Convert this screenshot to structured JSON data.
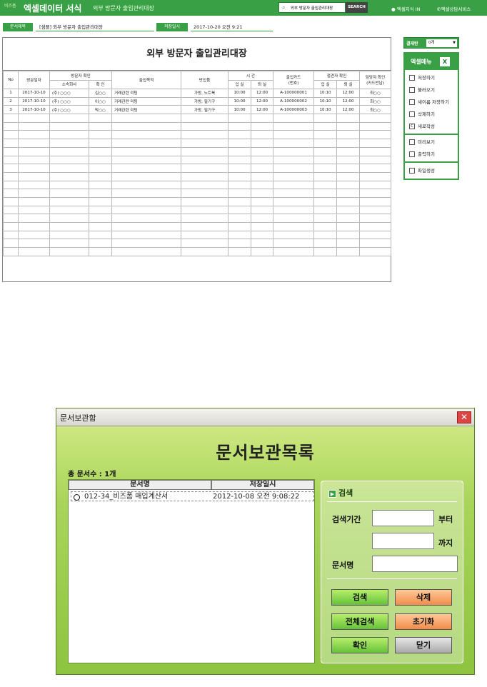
{
  "topbar": {
    "brand_small": "비즈폼",
    "brand": "엑셀데이터 서식",
    "subtitle": "외부 방문자 출입관리대장",
    "search_value": "외부 방문자 출입관리대장",
    "search_button": "SEARCH",
    "link1": "엑셀지식 IN",
    "link2": "엑셀상담서비스",
    "bg_color": "#3aa046"
  },
  "docinfo": {
    "name_label": "문서제목",
    "name_value": "[샘플] 외부 방문자 출입관리대장",
    "date_label": "저장일시",
    "date_value": "2017-10-20  오전 9:21"
  },
  "sheet": {
    "title": "외부 방문자 출입관리대장",
    "headers": {
      "no": "No",
      "date": "방문일자",
      "visitor": "방문자 확인",
      "company": "소속회사",
      "check": "확 인",
      "purpose": "출입목적",
      "items": "반입품",
      "time": "시 간",
      "time_in": "입 실",
      "time_out": "퇴 실",
      "card": "출입카드",
      "card_sub": "(번호)",
      "contact": "접견자 확인",
      "contact_in": "입 실",
      "contact_out": "퇴 실",
      "manager": "담당자 확인",
      "manager_sub": "(카드반납)"
    },
    "rows": [
      [
        "1",
        "2017-10-10",
        "(주) ○○○",
        "김○○",
        "거래관련 미팅",
        "가방, 노트북",
        "10:00",
        "12:00",
        "A-100000001",
        "10:10",
        "12:00",
        "최○○"
      ],
      [
        "2",
        "2017-10-10",
        "(주) ○○○",
        "이○○",
        "거래관련 미팅",
        "가방, 필기구",
        "10:00",
        "12:00",
        "A-100000002",
        "10:10",
        "12:00",
        "최○○"
      ],
      [
        "3",
        "2017-10-10",
        "(주) ○○○",
        "박○○",
        "거래관련 미팅",
        "가방, 필기구",
        "10:00",
        "12:00",
        "A-100000003",
        "10:10",
        "12:00",
        "최○○"
      ]
    ]
  },
  "side": {
    "approval_label": "결재란",
    "approval_value": "0개",
    "menu_title": "엑셀메뉴",
    "items": [
      "저장하기",
      "불러오기",
      "새이름 저장하기",
      "삭제하기",
      "새로작성",
      "미리보기",
      "출력하기",
      "파일생성"
    ]
  },
  "dialog": {
    "title": "문서보관함",
    "heading": "문서보관목록",
    "count": "총 문서수 : 1개",
    "col_name": "문서명",
    "col_date": "저장일시",
    "row_name": "012-34_비즈폼 매입계산서",
    "row_date": "2012-10-08 오전 9:08:22",
    "search_title": "검색",
    "period_label": "검색기간",
    "from_label": "부터",
    "to_label": "까지",
    "docname_label": "문서명",
    "btn_search": "검색",
    "btn_delete": "삭제",
    "btn_all": "전체검색",
    "btn_reset": "초기화",
    "btn_ok": "확인",
    "btn_close": "닫기"
  }
}
